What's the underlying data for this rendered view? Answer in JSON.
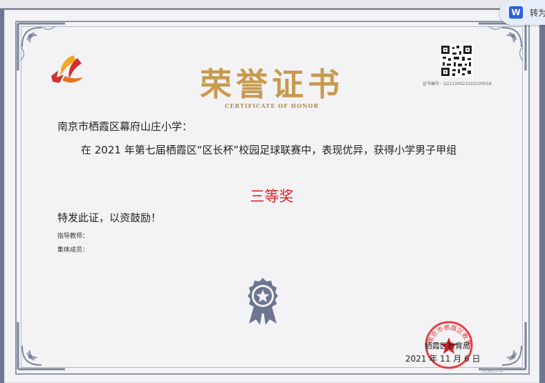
{
  "certificate": {
    "title": "荣誉证书",
    "subtitle": "CERTIFICATE OF HONOR",
    "cert_no": "证书编号：Q21130021022100018",
    "recipient": "南京市栖霞区幕府山庄小学：",
    "content": "在 2021 年第七届栖霞区“区长杯”校园足球联赛中，表现优异，获得小学男子甲组",
    "award": "三等奖",
    "closing": "特发此证，以资鼓励！",
    "teacher_label": "指导教师：",
    "members_label": "集体成员：",
    "issuer": "栖霞区教育局",
    "seal_text": "南京市栖霞区教育局",
    "date": "2021 年 11 月 6 日",
    "watermark": "熊猫办公"
  },
  "toolbar": {
    "convert_label": "转为",
    "word_icon": "W"
  },
  "colors": {
    "frame": "#8e95ab",
    "title": "#c89a4e",
    "award": "#e02020",
    "seal": "#e02020"
  }
}
